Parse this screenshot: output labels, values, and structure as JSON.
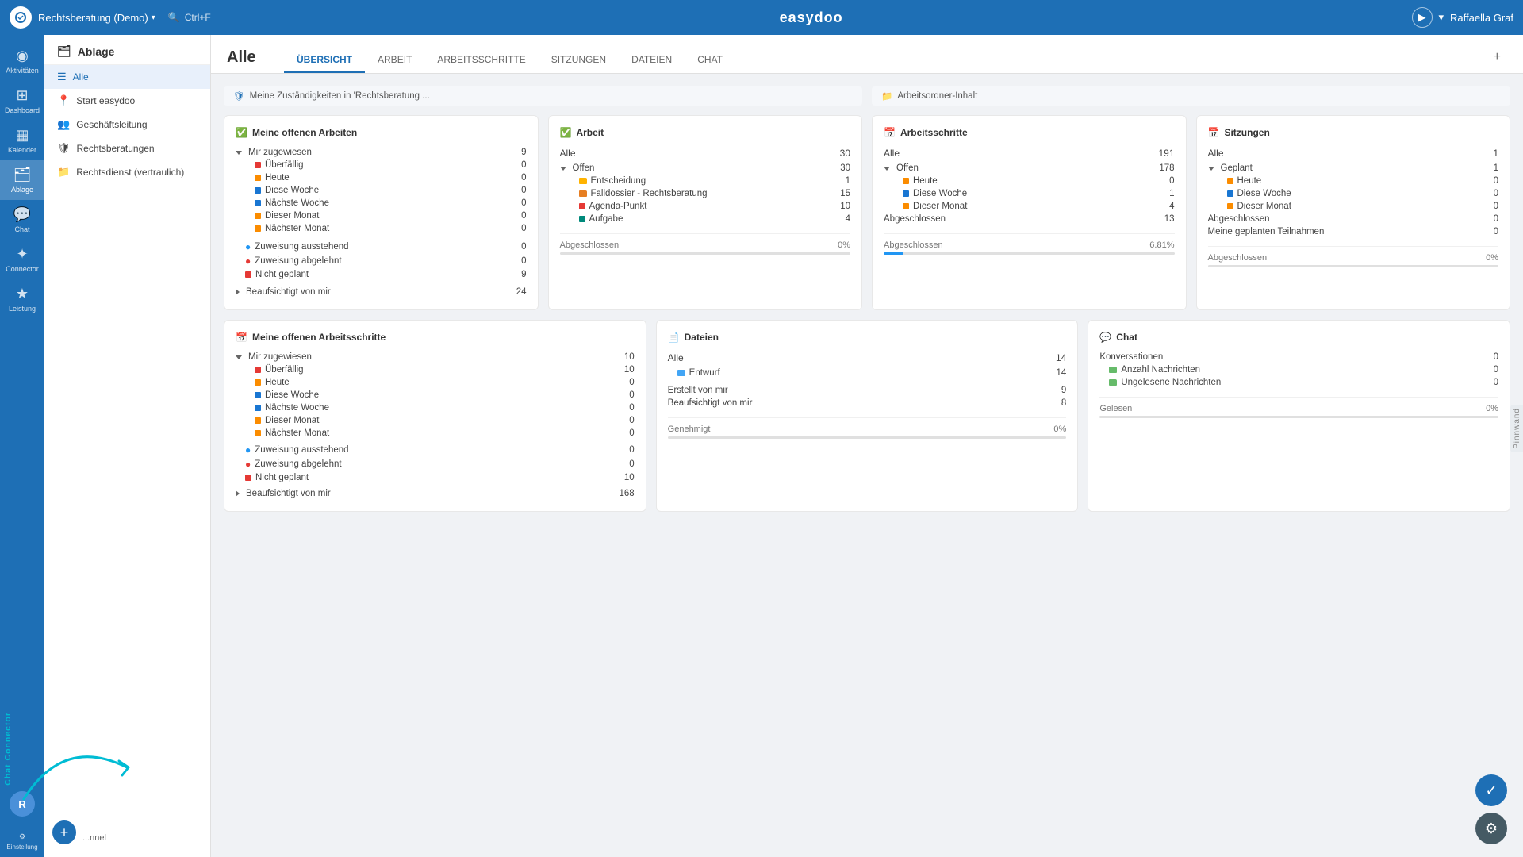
{
  "topbar": {
    "app_name": "Rechtsberatung (Demo)",
    "search_shortcut": "Ctrl+F",
    "brand": "easydoo",
    "user": "Raffaella Graf"
  },
  "sidebar": {
    "items": [
      {
        "id": "aktivitaeten",
        "label": "Aktivitäten",
        "icon": "◉"
      },
      {
        "id": "dashboard",
        "label": "Dashboard",
        "icon": "⊞"
      },
      {
        "id": "kalender",
        "label": "Kalender",
        "icon": "📅"
      },
      {
        "id": "ablage",
        "label": "Ablage",
        "icon": "🗂"
      },
      {
        "id": "chat",
        "label": "Chat",
        "icon": "💬"
      },
      {
        "id": "connector",
        "label": "Connector",
        "icon": "🔗"
      },
      {
        "id": "leistung",
        "label": "Leistung",
        "icon": "📊"
      }
    ]
  },
  "second_sidebar": {
    "title": "Ablage",
    "nav_items": [
      {
        "id": "alle",
        "label": "Alle",
        "icon": "☰"
      },
      {
        "id": "start",
        "label": "Start easydoo",
        "icon": "📍"
      },
      {
        "id": "geschaeft",
        "label": "Geschäftsleitung",
        "icon": "👥"
      },
      {
        "id": "rechtsberatungen",
        "label": "Rechtsberatungen",
        "icon": "🛡"
      },
      {
        "id": "rechtsdienst",
        "label": "Rechtsdienst (vertraulich)",
        "icon": "📁"
      }
    ]
  },
  "page": {
    "title": "Alle",
    "tabs": [
      {
        "id": "uebersicht",
        "label": "ÜBERSICHT",
        "active": true
      },
      {
        "id": "arbeit",
        "label": "ARBEIT"
      },
      {
        "id": "arbeitsschritte",
        "label": "ARBEITSSCHRITTE"
      },
      {
        "id": "sitzungen",
        "label": "SITZUNGEN"
      },
      {
        "id": "dateien",
        "label": "DATEIEN"
      },
      {
        "id": "chat",
        "label": "CHAT"
      }
    ]
  },
  "banners": {
    "zustaendigkeiten": "Meine Zuständigkeiten in 'Rechtsberatung ...",
    "arbeitsordner": "Arbeitsordner-Inhalt"
  },
  "card_meine_offene_arbeiten": {
    "title": "Meine offenen Arbeiten",
    "title_icon": "✅",
    "mir_zugewiesen_label": "Mir zugewiesen",
    "mir_zugewiesen_count": 9,
    "rows": [
      {
        "label": "Überfällig",
        "count": 0,
        "dot": "red"
      },
      {
        "label": "Heute",
        "count": 0,
        "dot": "orange"
      },
      {
        "label": "Diese Woche",
        "count": 0,
        "dot": "blue"
      },
      {
        "label": "Nächste Woche",
        "count": 0,
        "dot": "blue"
      },
      {
        "label": "Dieser Monat",
        "count": 0,
        "dot": "orange"
      },
      {
        "label": "Nächster Monat",
        "count": 0,
        "dot": "orange"
      }
    ],
    "zuweisung_ausstehend": {
      "label": "Zuweisung ausstehend",
      "count": 0,
      "dot": "blue"
    },
    "zuweisung_abgelehnt": {
      "label": "Zuweisung abgelehnt",
      "count": 0,
      "dot": "red"
    },
    "nicht_geplant": {
      "label": "Nicht geplant",
      "count": 9,
      "dot": "red"
    },
    "beaufsichtigt_label": "Beaufsichtigt von mir",
    "beaufsichtigt_count": 24
  },
  "card_arbeit": {
    "title": "Arbeit",
    "title_icon": "✅",
    "alle": 30,
    "offen": 30,
    "rows": [
      {
        "label": "Entscheidung",
        "count": 1,
        "dot": "folder"
      },
      {
        "label": "Falldossier - Rechtsberatung",
        "count": 15,
        "dot": "folder_orange"
      },
      {
        "label": "Agenda-Punkt",
        "count": 10,
        "dot": "red"
      },
      {
        "label": "Aufgabe",
        "count": 4,
        "dot": "teal"
      }
    ],
    "abgeschlossen_label": "Abgeschlossen",
    "abgeschlossen_pct": "0%"
  },
  "card_arbeitsschritte": {
    "title": "Arbeitsschritte",
    "title_icon": "🗓",
    "alle": 191,
    "offen": 178,
    "rows_offen": [
      {
        "label": "Heute",
        "count": 0,
        "dot": "orange"
      },
      {
        "label": "Diese Woche",
        "count": 1,
        "dot": "blue"
      },
      {
        "label": "Dieser Monat",
        "count": 4,
        "dot": "orange"
      }
    ],
    "abgeschlossen": 13,
    "abgeschlossen_label": "Abgeschlossen",
    "abgeschlossen_pct": "6.81%"
  },
  "card_sitzungen": {
    "title": "Sitzungen",
    "title_icon": "🗓",
    "alle": 1,
    "geplant": 1,
    "rows_geplant": [
      {
        "label": "Heute",
        "count": 0,
        "dot": "orange"
      },
      {
        "label": "Diese Woche",
        "count": 0,
        "dot": "blue"
      },
      {
        "label": "Dieser Monat",
        "count": 0,
        "dot": "orange"
      }
    ],
    "abgeschlossen": 0,
    "meine_geplanten": 0,
    "abgeschlossen_label": "Abgeschlossen",
    "abgeschlossen_pct": "0%"
  },
  "card_meine_offene_arbeitsschritte": {
    "title": "Meine offenen Arbeitsschritte",
    "title_icon": "🗓",
    "mir_zugewiesen_count": 10,
    "rows": [
      {
        "label": "Überfällig",
        "count": 10,
        "dot": "red"
      },
      {
        "label": "Heute",
        "count": 0,
        "dot": "orange"
      },
      {
        "label": "Diese Woche",
        "count": 0,
        "dot": "blue"
      },
      {
        "label": "Nächste Woche",
        "count": 0,
        "dot": "blue"
      },
      {
        "label": "Dieser Monat",
        "count": 0,
        "dot": "orange"
      },
      {
        "label": "Nächster Monat",
        "count": 0,
        "dot": "orange"
      }
    ],
    "zuweisung_ausstehend": 0,
    "zuweisung_abgelehnt": 0,
    "nicht_geplant": 10,
    "beaufsichtigt_count": 168
  },
  "card_dateien": {
    "title": "Dateien",
    "title_icon": "📄",
    "alle": 14,
    "entwurf": 14,
    "erstellt_von_mir": 9,
    "beaufsichtigt_von_mir": 8,
    "genehmigt_label": "Genehmigt",
    "genehmigt_pct": "0%"
  },
  "card_chat": {
    "title": "Chat",
    "title_icon": "💬",
    "konversationen": 0,
    "anzahl_nachrichten": 0,
    "ungelesene_nachrichten": 0,
    "gelesen_label": "Gelesen",
    "gelesen_pct": "0%"
  },
  "chat_connector": {
    "label": "Chat Connector"
  },
  "pinnwand": {
    "label": "Pinnwand"
  },
  "fab": {
    "check_icon": "✓",
    "gear_icon": "⚙"
  }
}
